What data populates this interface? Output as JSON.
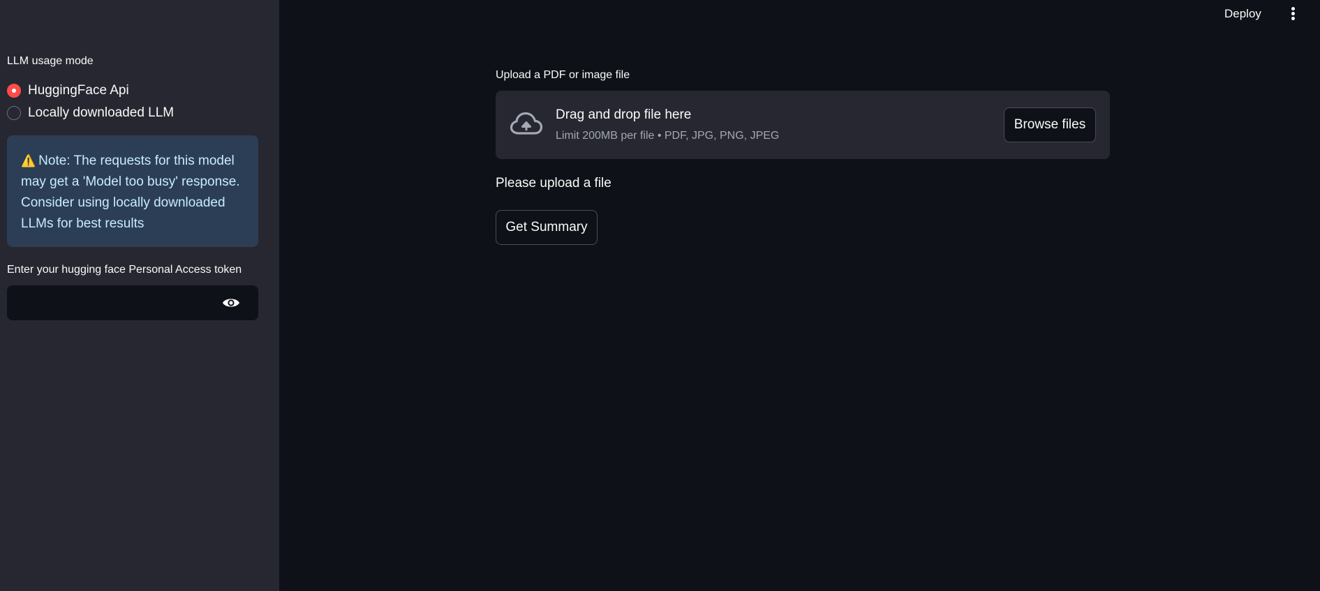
{
  "header": {
    "deploy_label": "Deploy",
    "menu_icon": "vertical-ellipsis-icon"
  },
  "sidebar": {
    "mode_label": "LLM usage mode",
    "options": [
      {
        "label": "HuggingFace Api",
        "selected": true
      },
      {
        "label": "Locally downloaded LLM",
        "selected": false
      }
    ],
    "alert": {
      "icon": "warning-icon",
      "text": "Note: The requests for this model may get a 'Model too busy' response. Consider using locally downloaded LLMs for best results"
    },
    "token_label": "Enter your hugging face Personal Access token",
    "token_value": "",
    "token_icon": "eye-icon"
  },
  "main": {
    "upload_label": "Upload a PDF or image file",
    "dropzone": {
      "icon": "cloud-upload-icon",
      "title": "Drag and drop file here",
      "subtitle": "Limit 200MB per file • PDF, JPG, PNG, JPEG",
      "browse_label": "Browse files"
    },
    "status_text": "Please upload a file",
    "summary_button_label": "Get Summary"
  },
  "colors": {
    "main_background": "#0e1117",
    "sidebar_background": "#262730",
    "accent": "#ff4b4b",
    "alert_background": "#2c3e55",
    "alert_text": "#c7ebff"
  }
}
